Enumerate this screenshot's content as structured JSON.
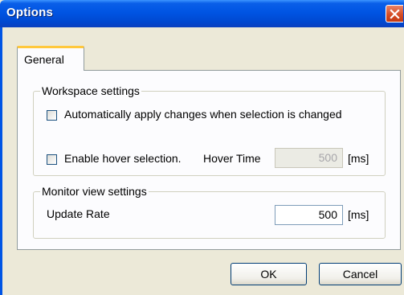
{
  "window": {
    "title": "Options"
  },
  "tabs": [
    {
      "label": "General",
      "active": true
    }
  ],
  "workspace": {
    "group_title": "Workspace settings",
    "auto_apply": {
      "label": "Automatically apply changes when selection is changed",
      "checked": false
    },
    "hover": {
      "label": "Enable hover selection.",
      "checked": false,
      "time_label": "Hover Time",
      "time_value": "500",
      "unit": "[ms]",
      "enabled": false
    }
  },
  "monitor": {
    "group_title": "Monitor view settings",
    "update_rate_label": "Update Rate",
    "update_rate_value": "500",
    "unit": "[ms]"
  },
  "buttons": {
    "ok": "OK",
    "cancel": "Cancel"
  },
  "colors": {
    "titlebar": "#0054E3",
    "dialog_bg": "#ECE9D8",
    "panel_bg": "#FCFCFE",
    "tab_highlight": "#FFC83C",
    "close_button": "#D44A21"
  },
  "icons": {
    "close": "close-icon"
  }
}
